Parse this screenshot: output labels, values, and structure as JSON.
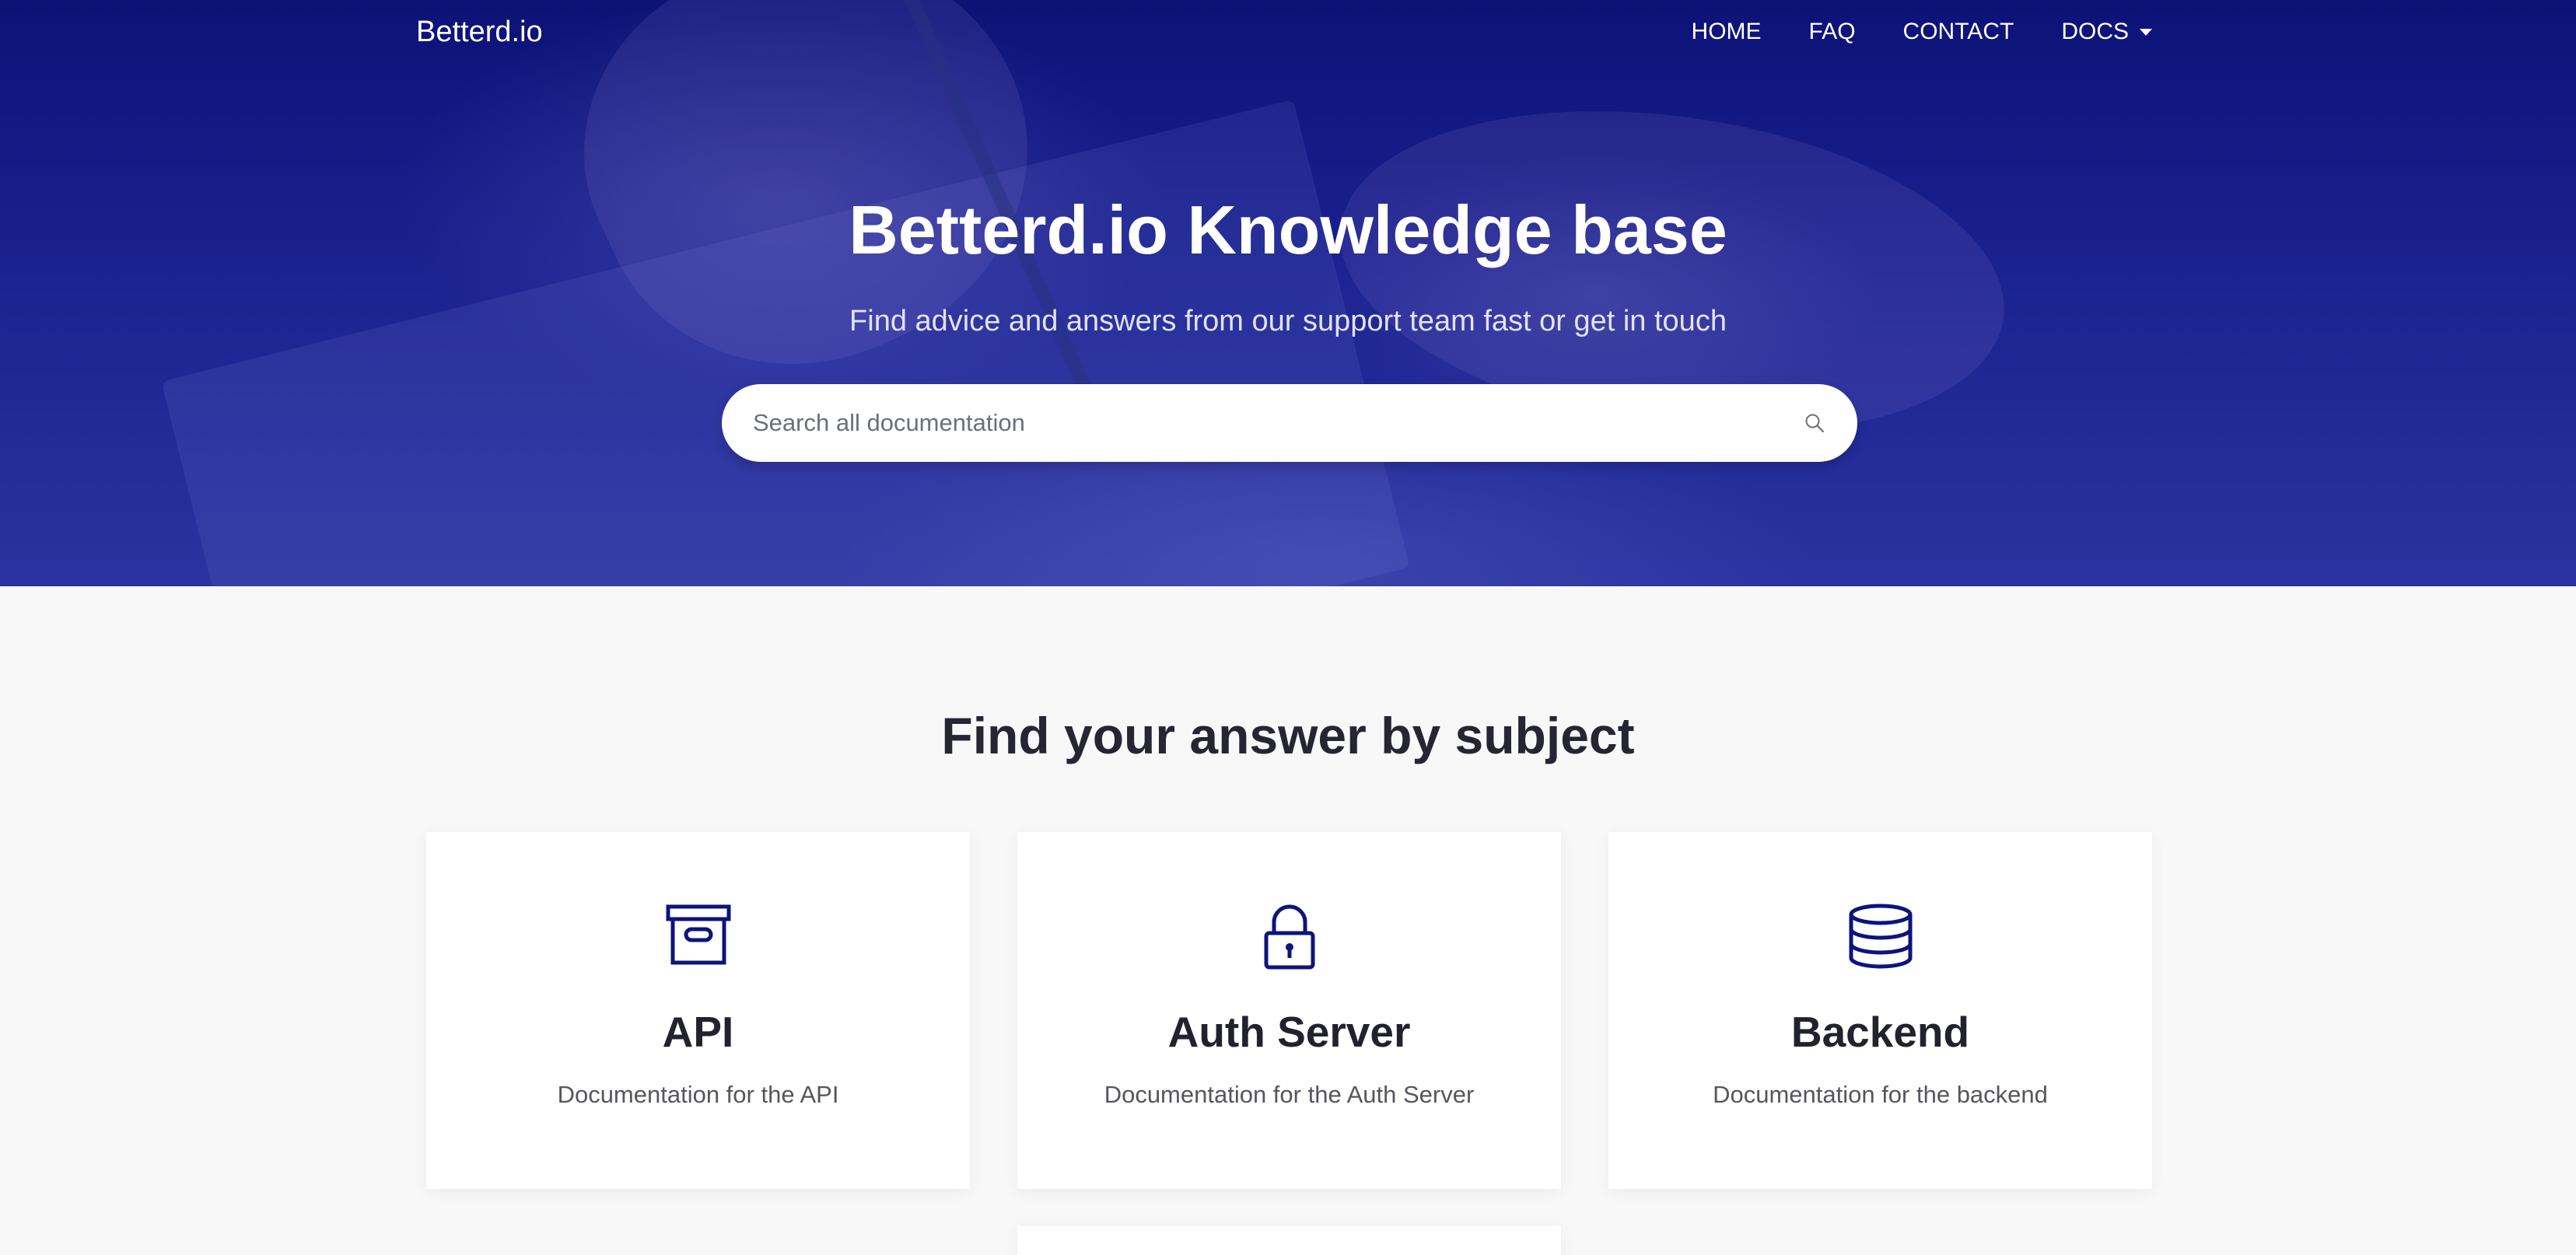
{
  "nav": {
    "brand": "Betterd.io",
    "links": [
      {
        "label": "HOME"
      },
      {
        "label": "FAQ"
      },
      {
        "label": "CONTACT"
      },
      {
        "label": "DOCS"
      }
    ]
  },
  "hero": {
    "title": "Betterd.io Knowledge base",
    "subtitle": "Find advice and answers from our support team fast or get in touch",
    "search": {
      "placeholder": "Search all documentation",
      "value": "",
      "icon": "search-icon"
    }
  },
  "subjects": {
    "title": "Find your answer by subject",
    "cards": [
      {
        "icon": "archive-box-icon",
        "title": "API",
        "description": "Documentation for the API"
      },
      {
        "icon": "lock-icon",
        "title": "Auth Server",
        "description": "Documentation for the Auth Server"
      },
      {
        "icon": "database-icon",
        "title": "Backend",
        "description": "Documentation for the backend"
      }
    ]
  },
  "colors": {
    "hero_bg": "#0d147a",
    "icon": "#0d147a",
    "page_bg": "#f8f8f8",
    "card_bg": "#ffffff"
  }
}
